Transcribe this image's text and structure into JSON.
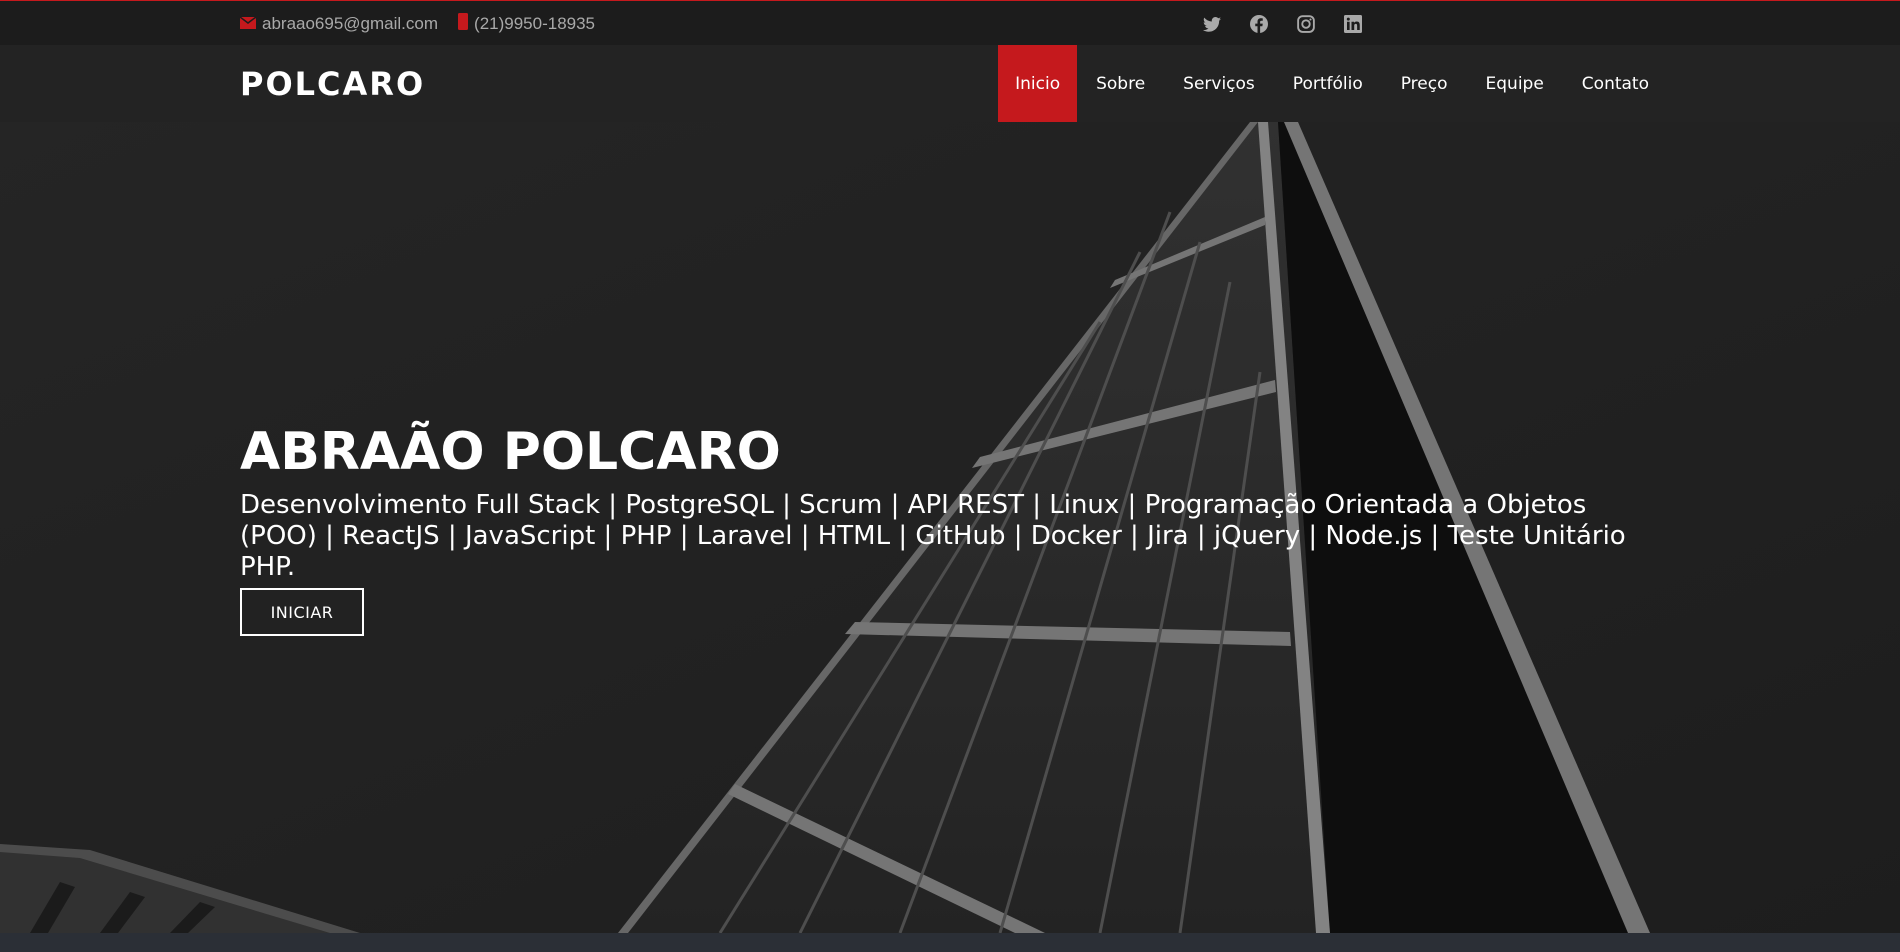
{
  "topbar": {
    "email": "abraao695@gmail.com",
    "phone": "(21)9950-18935",
    "email_icon": "envelope-icon",
    "phone_icon": "phone-icon",
    "social": [
      "twitter-icon",
      "facebook-icon",
      "instagram-icon",
      "linkedin-icon"
    ]
  },
  "header": {
    "logo": "POLCARO",
    "nav": [
      "Inicio",
      "Sobre",
      "Serviços",
      "Portfólio",
      "Preço",
      "Equipe",
      "Contato"
    ],
    "active_nav": "Inicio"
  },
  "hero": {
    "title": "ABRAÃO POLCARO",
    "subtitle": "Desenvolvimento Full Stack | PostgreSQL | Scrum | API REST | Linux | Programação Orientada a Objetos (POO) | ReactJS | JavaScript | PHP | Laravel | HTML | GitHub | Docker | Jira | jQuery | Node.js | Teste Unitário PHP.",
    "button": "INICIAR"
  },
  "colors": {
    "accent": "#c5191d",
    "topbar_bg": "#1c1c1c",
    "header_bg": "#232323",
    "hero_bg": "#2a2a2a"
  }
}
